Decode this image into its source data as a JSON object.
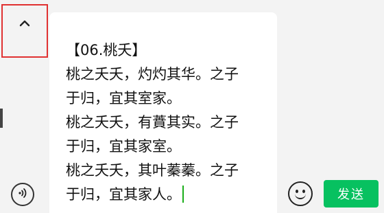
{
  "composer": {
    "text_lines": [
      "【06.桃夭】",
      "桃之夭夭，灼灼其华。之子",
      "于归，宜其室家。",
      "桃之夭夭，有蕡其实。之子",
      "于归，宜其家室。",
      "桃之夭夭，其叶蓁蓁。之子",
      "于归，宜其家人。"
    ],
    "send_label": "发送"
  },
  "icons": {
    "collapse": "chevron-up-icon",
    "voice": "voice-input-icon",
    "emoji": "emoji-icon"
  },
  "colors": {
    "send_button": "#07c160",
    "highlight_box": "#e03131",
    "caret": "#1aad19"
  }
}
